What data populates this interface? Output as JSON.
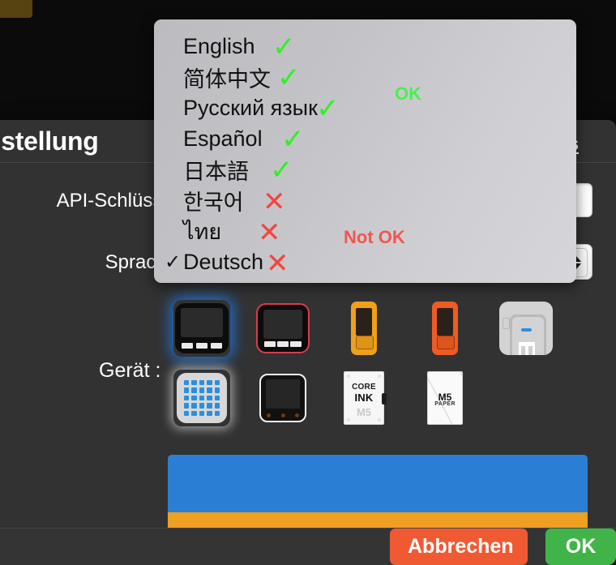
{
  "dialog": {
    "title": "nstellung",
    "tips_link": "ps",
    "rows": [
      {
        "label": "API-Schlüssel",
        "value": "",
        "placeholder": ""
      },
      {
        "label": "Sprache",
        "value": "Deutsch"
      }
    ],
    "device_label": "Gerät :"
  },
  "footer": {
    "cancel_label": "Abbrechen",
    "ok_label": "OK"
  },
  "devices": {
    "row1": [
      {
        "name": "m5-core-blue",
        "caption": ""
      },
      {
        "name": "m5-core-red",
        "caption": ""
      },
      {
        "name": "m5-stick-orange",
        "caption": ""
      },
      {
        "name": "m5-stick-red",
        "caption": ""
      },
      {
        "name": "m5-station",
        "caption": ""
      }
    ],
    "row2": [
      {
        "name": "m5-atom-matrix",
        "caption": ""
      },
      {
        "name": "m5-core2",
        "caption": ""
      },
      {
        "name": "m5-core-ink",
        "caption_top": "CORE",
        "caption_mid": "INK",
        "caption_bottom": "M5"
      },
      {
        "name": "m5-paper",
        "caption_top": "M5",
        "caption_bottom": "PAPER"
      }
    ]
  },
  "dropdown": {
    "items": [
      {
        "label": "English",
        "selected": false,
        "mark": "check",
        "check": ""
      },
      {
        "label": "简体中文",
        "selected": false,
        "mark": "check",
        "check": ""
      },
      {
        "label": "Русский язык",
        "selected": false,
        "mark": "check",
        "check": ""
      },
      {
        "label": "Español",
        "selected": false,
        "mark": "check",
        "check": ""
      },
      {
        "label": "日本語",
        "selected": false,
        "mark": "check",
        "check": ""
      },
      {
        "label": "한국어",
        "selected": false,
        "mark": "cross",
        "check": ""
      },
      {
        "label": "ไทย",
        "selected": false,
        "mark": "cross",
        "check": ""
      },
      {
        "label": "Deutsch",
        "selected": true,
        "mark": "cross",
        "check": "✓"
      }
    ],
    "glyph_check": "✓",
    "glyph_cross": "✕",
    "annotation_ok": "OK",
    "annotation_not_ok": "Not OK"
  },
  "colors": {
    "mark_ok": "#2ff024",
    "mark_not_ok": "#f4453e",
    "annotation_ok": "#49f050",
    "annotation_not_ok": "#f0564f",
    "cancel_button": "#f05a33",
    "ok_button": "#41b449",
    "bar_blue": "#2a7fd4",
    "bar_orange": "#eda022",
    "dialog_bg": "#323232"
  }
}
